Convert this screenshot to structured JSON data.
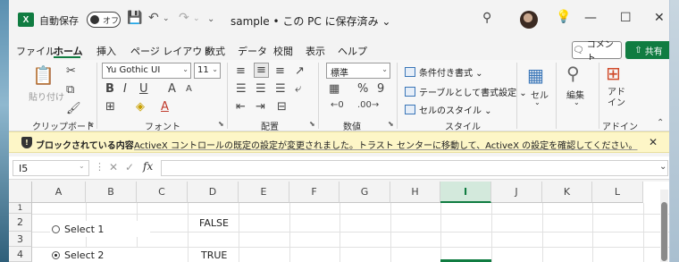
{
  "title": {
    "autosave_label": "自動保存",
    "autosave_state": "オフ",
    "file_title": "sample • この PC に保存済み ⌄"
  },
  "menu": {
    "items": [
      "ファイル",
      "ホーム",
      "挿入",
      "ページ レイアウト",
      "数式",
      "データ",
      "校閲",
      "表示",
      "ヘルプ"
    ],
    "comment_label": "コメント",
    "share_label": "共有"
  },
  "ribbon": {
    "clipboard": {
      "paste_label": "貼り付け",
      "group_label": "クリップボード"
    },
    "font": {
      "name": "Yu Gothic UI",
      "size": "11",
      "group_label": "フォント",
      "bold": "B",
      "italic": "I",
      "underline": "U",
      "grow": "A",
      "shrink": "A"
    },
    "alignment": {
      "group_label": "配置"
    },
    "number": {
      "format": "標準",
      "group_label": "数値",
      "percent": "%",
      "comma": "9"
    },
    "styles": {
      "conditional": "条件付き書式 ⌄",
      "table": "テーブルとして書式設定 ⌄",
      "cell_styles": "セルのスタイル ⌄",
      "group_label": "スタイル"
    },
    "cells": {
      "label": "セル"
    },
    "editing": {
      "label": "編集"
    },
    "addins": {
      "label": "アド\nイン",
      "group_label": "アドイン"
    }
  },
  "message_bar": {
    "title": "ブロックされている内容",
    "text": "ActiveX コントロールの既定の設定が変更されました。トラスト センターに移動して、ActiveX の設定を確認してください。"
  },
  "formula_bar": {
    "name_box": "I5",
    "fx": "fx",
    "cancel": "✕",
    "confirm": "✓"
  },
  "sheet": {
    "columns": [
      "A",
      "B",
      "C",
      "D",
      "E",
      "F",
      "G",
      "H",
      "I",
      "J",
      "K",
      "L"
    ],
    "selected_column": "I",
    "rows": [
      "1",
      "2",
      "3",
      "4"
    ],
    "cells": {
      "D2": "FALSE",
      "D4": "TRUE"
    },
    "radio1": "Select 1",
    "radio2": "Select 2",
    "radio2_checked": true
  }
}
